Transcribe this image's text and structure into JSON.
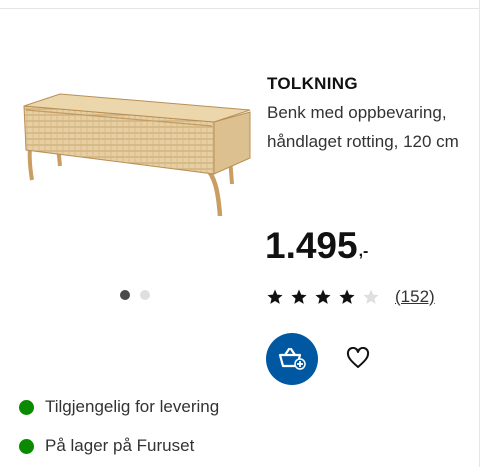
{
  "product": {
    "name": "TOLKNING",
    "description": "Benk med oppbevaring, håndlaget rotting, 120 cm",
    "price": "1.495",
    "price_suffix": ",-",
    "rating": {
      "stars": 4,
      "max_stars": 5,
      "reviews_label": "(152)"
    }
  },
  "carousel": {
    "total": 2,
    "active": 1
  },
  "actions": {
    "cart_icon": "add-to-cart-icon",
    "favorite_icon": "heart-icon"
  },
  "availability": [
    {
      "label": "Tilgjengelig for levering",
      "status_color": "#0a8a00"
    },
    {
      "label": "På lager på Furuset",
      "status_color": "#0a8a00"
    }
  ],
  "colors": {
    "accent": "#0058a3",
    "star": "#111111",
    "star_empty": "#dfdfdf"
  }
}
